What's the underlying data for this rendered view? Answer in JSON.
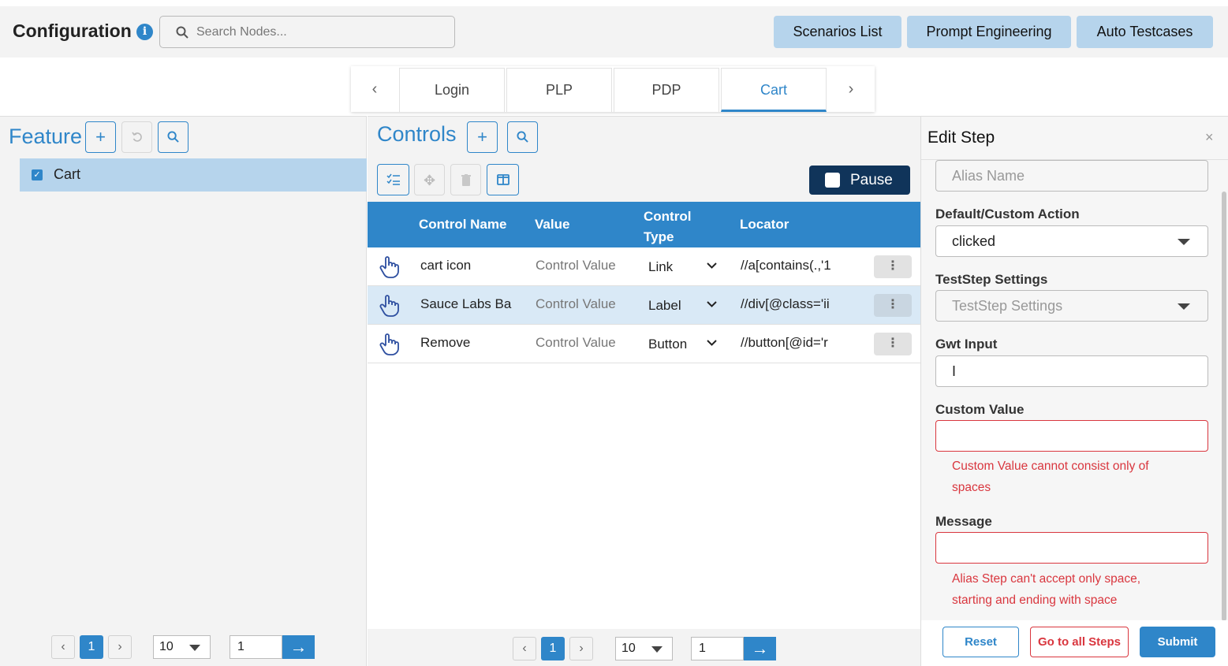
{
  "header": {
    "title": "Configuration",
    "search_placeholder": "Search Nodes...",
    "buttons": [
      "Scenarios List",
      "Prompt Engineering",
      "Auto Testcases"
    ]
  },
  "tabs": {
    "items": [
      "Login",
      "PLP",
      "PDP",
      "Cart"
    ],
    "active": "Cart"
  },
  "feature": {
    "title": "Feature",
    "items": [
      {
        "label": "Cart",
        "checked": true
      }
    ],
    "pager": {
      "page": "1",
      "size": "10",
      "goto": "1"
    }
  },
  "controls": {
    "title": "Controls",
    "pause_label": "Pause",
    "columns": [
      "Control Name",
      "Value",
      "Control Type",
      "Locator"
    ],
    "column_type_line1": "Control",
    "column_type_line2": "Type",
    "rows": [
      {
        "name": "cart icon",
        "value": "Control Value",
        "type": "Link",
        "locator": "//a[contains(.,'1"
      },
      {
        "name": "Sauce Labs Ba",
        "value": "Control Value",
        "type": "Label",
        "locator": "//div[@class='ii"
      },
      {
        "name": "Remove",
        "value": "Control Value",
        "type": "Button",
        "locator": "//button[@id='r"
      }
    ],
    "pager": {
      "page": "1",
      "size": "10",
      "goto": "1"
    }
  },
  "edit_step": {
    "title": "Edit Step",
    "close": "×",
    "alias_placeholder": "Alias Name",
    "action_label": "Default/Custom Action",
    "action_value": "clicked",
    "settings_label": "TestStep Settings",
    "settings_placeholder": "TestStep Settings",
    "gwt_label": "Gwt Input",
    "gwt_value": "I",
    "custom_label": "Custom Value",
    "custom_error": "Custom Value cannot consist only of spaces",
    "message_label": "Message",
    "message_error": "Alias Step can't accept only space, starting and ending with space",
    "buttons": {
      "reset": "Reset",
      "all_steps": "Go to all Steps",
      "submit": "Submit"
    }
  },
  "colors": {
    "accent": "#2f86c9",
    "dark": "#10345a",
    "error": "#d9363e",
    "highlight": "#b6d4ec"
  }
}
